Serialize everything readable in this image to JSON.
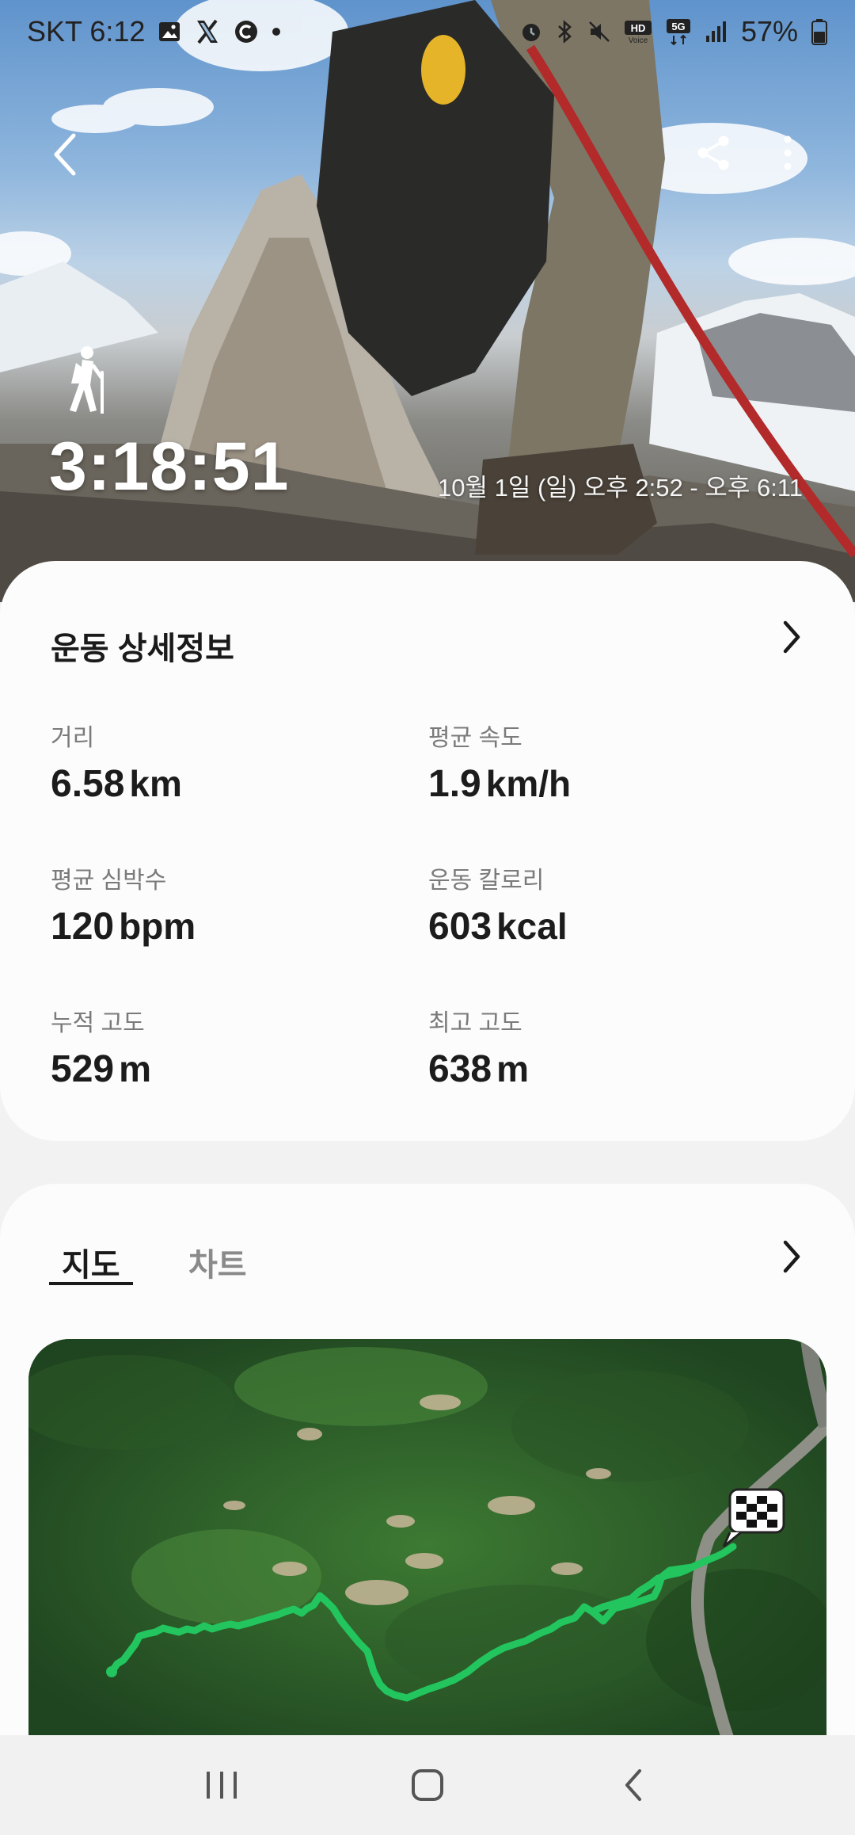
{
  "status_bar": {
    "carrier_time": "SKT 6:12",
    "battery": "57%",
    "icons": [
      "gallery-icon",
      "x-app-icon",
      "c-app-icon",
      "dot-icon",
      "alarm-icon",
      "bluetooth-icon",
      "mute-icon",
      "hd-voice-icon",
      "5g-icon",
      "signal-icon",
      "battery-icon"
    ]
  },
  "header": {
    "back_icon": "chevron-left-icon",
    "share_icon": "share-icon",
    "more_icon": "more-vertical-icon",
    "activity_icon": "hiking-icon",
    "duration": "3:18:51",
    "time_range": "10월 1일 (일) 오후 2:52 - 오후 6:11"
  },
  "details": {
    "title": "운동 상세정보",
    "metrics": [
      {
        "label": "거리",
        "value": "6.58",
        "unit": "km"
      },
      {
        "label": "평균 속도",
        "value": "1.9",
        "unit": "km/h"
      },
      {
        "label": "평균 심박수",
        "value": "120",
        "unit": "bpm"
      },
      {
        "label": "운동 칼로리",
        "value": "603",
        "unit": "kcal"
      },
      {
        "label": "누적 고도",
        "value": "529",
        "unit": "m"
      },
      {
        "label": "최고 고도",
        "value": "638",
        "unit": "m"
      }
    ]
  },
  "map_section": {
    "tabs": [
      {
        "label": "지도",
        "active": true
      },
      {
        "label": "차트",
        "active": false
      }
    ],
    "route_color": "#22c55e",
    "finish_icon": "checkered-flag-icon"
  },
  "nav_bar": {
    "icons": [
      "recent-apps-icon",
      "home-icon",
      "back-icon"
    ]
  }
}
